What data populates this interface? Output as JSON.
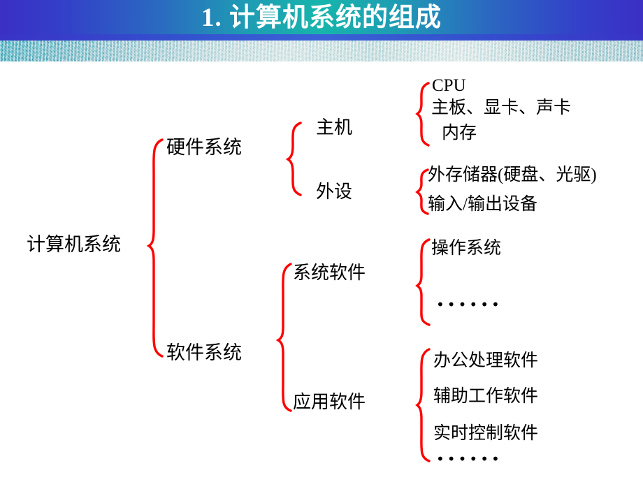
{
  "slide": {
    "title": "1. 计算机系统的组成",
    "title_color": "#ffffff",
    "banner_gradient_ends": "#3b2fc4",
    "banner_gradient_center": "#17b5ab",
    "brace_color": "#ff0000",
    "text_color": "#000000",
    "background": "#ffffff"
  },
  "diagram": {
    "root": "计算机系统",
    "level1": {
      "hardware": "硬件系统",
      "software": "软件系统"
    },
    "level2": {
      "host": "主机",
      "peripheral": "外设",
      "system_software": "系统软件",
      "application_software": "应用软件"
    },
    "level3": {
      "host_items": [
        "CPU",
        "主板、显卡、声卡",
        "内存"
      ],
      "peripheral_items": [
        "外存储器(硬盘、光驱)",
        "输入/输出设备"
      ],
      "system_software_items": [
        "操作系统"
      ],
      "system_software_ellipsis": "••••••",
      "application_software_items": [
        "办公处理软件",
        "辅助工作软件",
        "实时控制软件"
      ],
      "application_software_ellipsis": "••••••"
    }
  }
}
